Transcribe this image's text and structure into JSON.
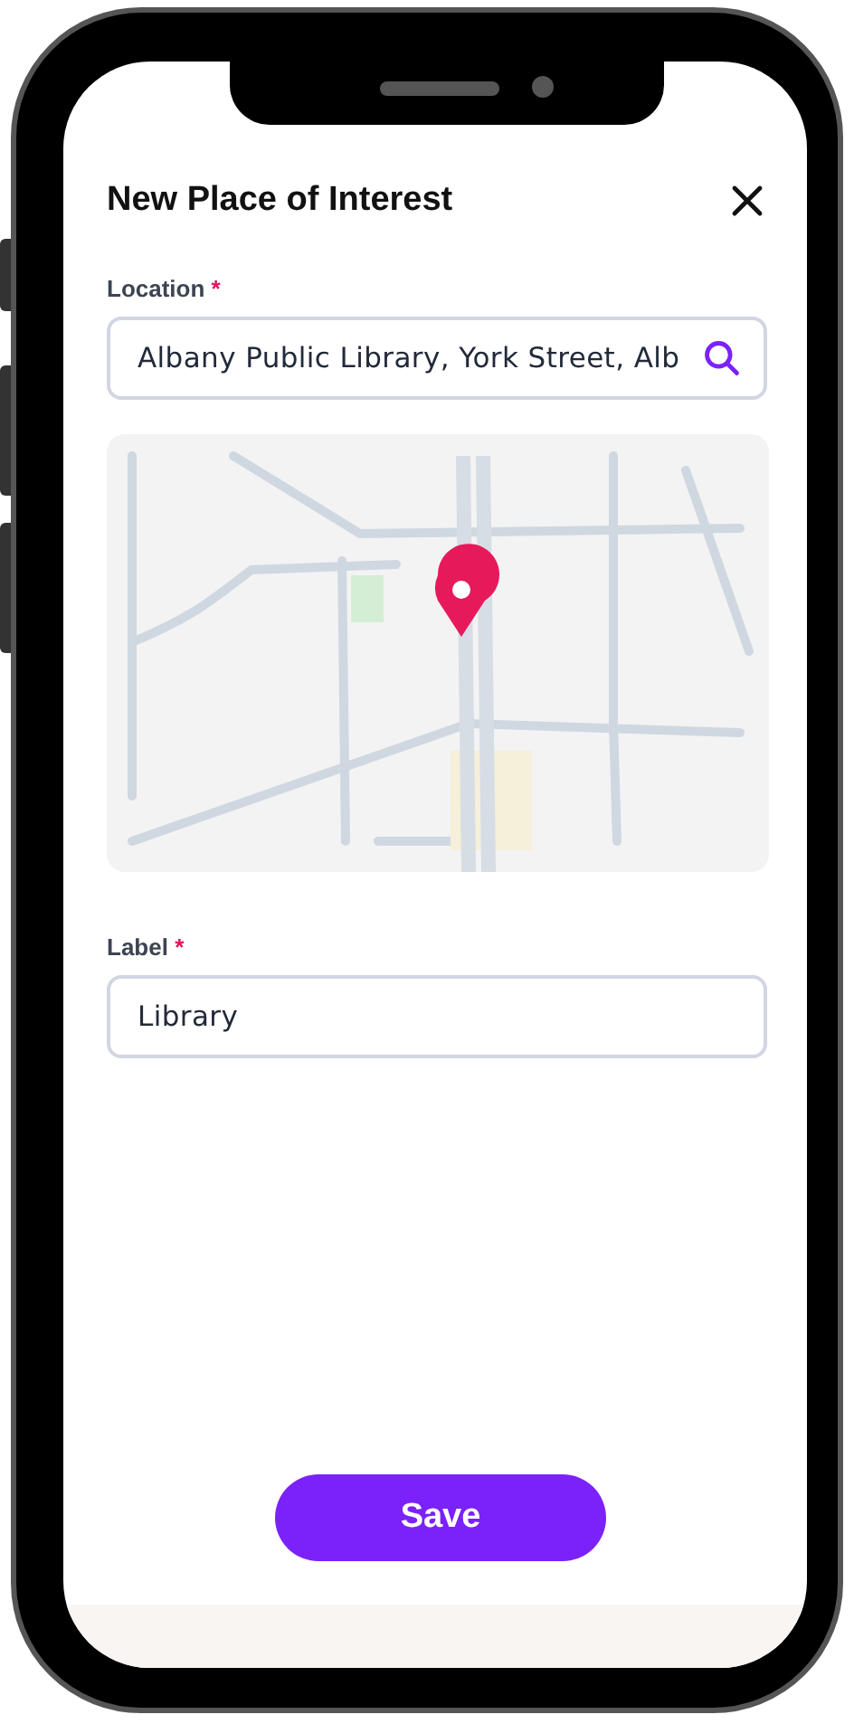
{
  "dialog": {
    "title": "New Place of Interest"
  },
  "fields": [
    {
      "label": "Location",
      "required_mark": "*",
      "value": "Albany Public Library, York Street, Alb",
      "kind": "search"
    },
    {
      "label": "Label",
      "required_mark": "*",
      "value": "Library",
      "kind": "text"
    }
  ],
  "save_button": {
    "label": "Save"
  }
}
